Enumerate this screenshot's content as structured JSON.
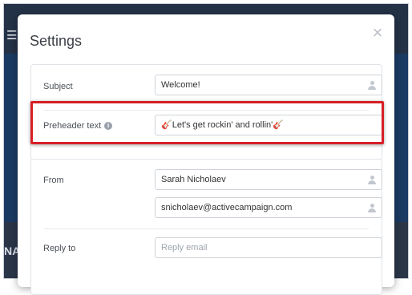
{
  "background": {
    "left_letters": "NA"
  },
  "modal": {
    "title": "Settings",
    "close_glyph": "×"
  },
  "subject": {
    "label": "Subject",
    "value": "Welcome!"
  },
  "preheader": {
    "label": "Preheader text",
    "info_glyph": "i",
    "value": "Let's get rockin' and rollin'",
    "emoji": "🎸"
  },
  "from": {
    "label": "From",
    "name_value": "Sarah Nicholaev",
    "email_value": "snicholaev@activecampaign.com"
  },
  "reply_to": {
    "label": "Reply to",
    "placeholder": "Reply email"
  },
  "colors": {
    "highlight": "#d81f26",
    "backdrop": "#1f2c3f"
  },
  "icons": [
    "hamburger-icon",
    "close-icon",
    "info-icon",
    "person-icon",
    "guitar-icon"
  ]
}
